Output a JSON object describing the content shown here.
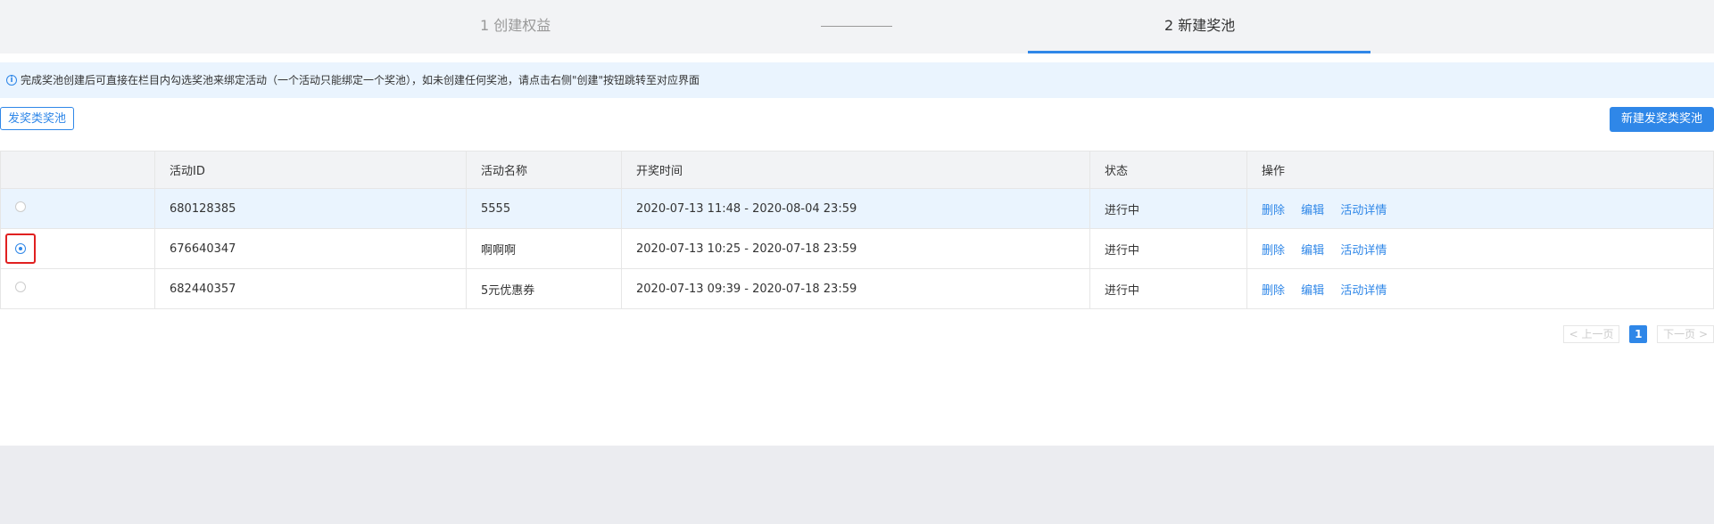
{
  "steps": {
    "step1": "1 创建权益",
    "step2": "2 新建奖池"
  },
  "notice": {
    "icon": "info-icon",
    "text": "完成奖池创建后可直接在栏目内勾选奖池来绑定活动（一个活动只能绑定一个奖池），如未创建任何奖池，请点击右侧\"创建\"按钮跳转至对应界面"
  },
  "toolbar": {
    "pool_type": "发奖类奖池",
    "new_pool_button": "新建发奖类奖池"
  },
  "table": {
    "headers": [
      "活动ID",
      "活动名称",
      "开奖时间",
      "状态",
      "操作"
    ],
    "rows": [
      {
        "id": "680128385",
        "name": "5555",
        "time": "2020-07-13 11:48 - 2020-08-04 23:59",
        "status": "进行中",
        "selected": false
      },
      {
        "id": "676640347",
        "name": "啊啊啊",
        "time": "2020-07-13 10:25 - 2020-07-18 23:59",
        "status": "进行中",
        "selected": true
      },
      {
        "id": "682440357",
        "name": "5元优惠券",
        "time": "2020-07-13 09:39 - 2020-07-18 23:59",
        "status": "进行中",
        "selected": false
      }
    ],
    "actions": {
      "delete": "删除",
      "edit": "编辑",
      "detail": "活动详情"
    }
  },
  "pagination": {
    "prev": "< 上一页",
    "current": "1",
    "next": "下一页 >"
  },
  "colors": {
    "accent": "#2f87e8",
    "highlight_border": "#e02020",
    "notice_bg": "#eaf4fe"
  }
}
